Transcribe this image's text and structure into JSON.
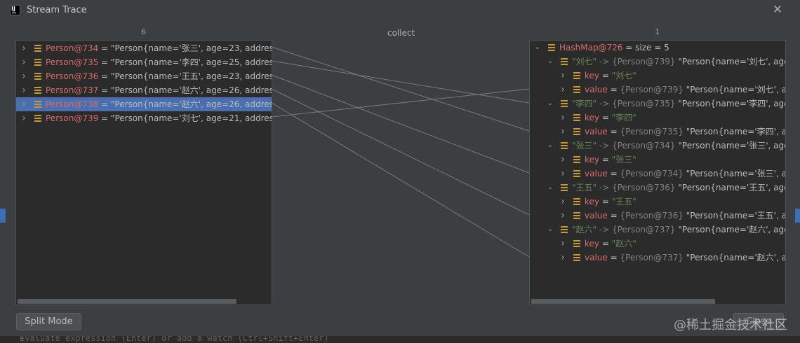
{
  "window": {
    "title": "Stream Trace",
    "app_icon_text": "IJ"
  },
  "columns": {
    "left_count": "6",
    "middle_title": "collect",
    "right_count": "1"
  },
  "left_items": [
    {
      "name": "Person@734",
      "value": " = \"Person{name='张三', age=23, address=",
      "selected": false
    },
    {
      "name": "Person@735",
      "value": " = \"Person{name='李四', age=25, address=",
      "selected": false
    },
    {
      "name": "Person@736",
      "value": " = \"Person{name='王五', age=23, address=",
      "selected": false
    },
    {
      "name": "Person@737",
      "value": " = \"Person{name='赵六', age=26, address=",
      "selected": false
    },
    {
      "name": "Person@738",
      "value": " = \"Person{name='赵六', age=26, address=",
      "selected": true
    },
    {
      "name": "Person@739",
      "value": " = \"Person{name='刘七', age=21, address=",
      "selected": false
    }
  ],
  "right_root": {
    "name": "HashMap@726",
    "suffix": " =  size = 5"
  },
  "right_entries": [
    {
      "key": "\"刘七\"",
      "arrow": " -> ",
      "ref": "{Person@739}",
      "desc": " \"Person{name='刘七', age=2",
      "key_label": "key",
      "key_eq": " = ",
      "key_val": "\"刘七\"",
      "val_label": "value",
      "val_eq": " = ",
      "val_ref": "{Person@739}",
      "val_desc": " \"Person{name='刘七', age="
    },
    {
      "key": "\"李四\"",
      "arrow": " -> ",
      "ref": "{Person@735}",
      "desc": " \"Person{name='李四', age=2",
      "key_label": "key",
      "key_eq": " = ",
      "key_val": "\"李四\"",
      "val_label": "value",
      "val_eq": " = ",
      "val_ref": "{Person@735}",
      "val_desc": " \"Person{name='李四', age="
    },
    {
      "key": "\"张三\"",
      "arrow": " -> ",
      "ref": "{Person@734}",
      "desc": " \"Person{name='张三', age=2",
      "key_label": "key",
      "key_eq": " = ",
      "key_val": "\"张三\"",
      "val_label": "value",
      "val_eq": " = ",
      "val_ref": "{Person@734}",
      "val_desc": " \"Person{name='张三', age="
    },
    {
      "key": "\"王五\"",
      "arrow": " -> ",
      "ref": "{Person@736}",
      "desc": " \"Person{name='王五', age=2",
      "key_label": "key",
      "key_eq": " = ",
      "key_val": "\"王五\"",
      "val_label": "value",
      "val_eq": " = ",
      "val_ref": "{Person@736}",
      "val_desc": " \"Person{name='王五', age="
    },
    {
      "key": "\"赵六\"",
      "arrow": " -> ",
      "ref": "{Person@737}",
      "desc": " \"Person{name='赵六', age=2",
      "key_label": "key",
      "key_eq": " = ",
      "key_val": "\"赵六\"",
      "val_label": "value",
      "val_eq": " = ",
      "val_ref": "{Person@737}",
      "val_desc": " \"Person{name='赵六', age="
    }
  ],
  "buttons": {
    "split_mode": "Split Mode",
    "close": "Close"
  },
  "watermark": "@稀土掘金技术社区",
  "bottom_hint": "Evaluate expression (Enter) or add a watch (Ctrl+Shift+Enter)",
  "colors": {
    "selection": "#4b6eaf",
    "object_name": "#e06c75",
    "string": "#6a8759",
    "field_icon": "#c59a3c"
  }
}
